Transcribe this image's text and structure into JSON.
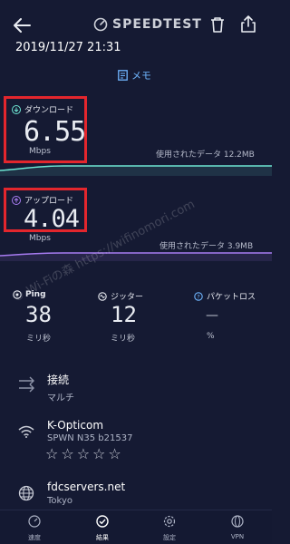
{
  "header": {
    "logo_text": "SPEEDTEST",
    "timestamp": "2019/11/27 21:31",
    "memo_label": "メモ"
  },
  "download": {
    "label": "ダウンロード",
    "value": "6.55",
    "unit": "Mbps",
    "data_used": "使用されたデータ 12.2MB",
    "color": "#6ee7d4"
  },
  "upload": {
    "label": "アップロード",
    "value": "4.04",
    "unit": "Mbps",
    "data_used": "使用されたデータ 3.9MB",
    "color": "#a87cf2"
  },
  "ping": {
    "label": "Ping",
    "value": "38",
    "unit": "ミリ秒"
  },
  "jitter": {
    "label": "ジッター",
    "value": "12",
    "unit": "ミリ秒"
  },
  "packet_loss": {
    "label": "パケットロス",
    "value": "—",
    "unit": "%"
  },
  "connection": {
    "title": "接続",
    "subtitle": "マルチ"
  },
  "provider": {
    "title": "K-Opticom",
    "subtitle": "SPWN N35 b21537",
    "stars": "☆☆☆☆☆"
  },
  "server": {
    "title": "fdcservers.net",
    "subtitle": "Tokyo"
  },
  "watermark": "© Wi-Fiの森 https://wifinomori.com",
  "nav": {
    "speed": "速度",
    "results": "結果",
    "settings": "設定",
    "vpn": "VPN"
  },
  "colors": {
    "background": "#151a33",
    "highlight_box": "#e3262d",
    "memo": "#6fb6ff"
  }
}
